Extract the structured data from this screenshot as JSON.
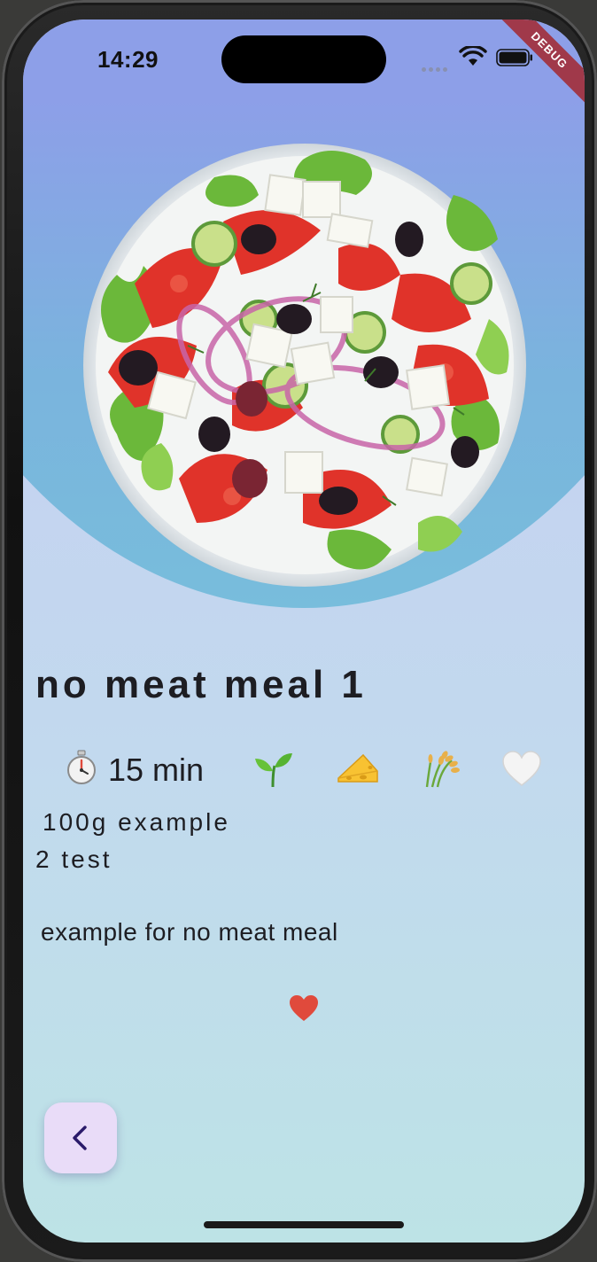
{
  "status_bar": {
    "time": "14:29",
    "icons": [
      "signal-dots-icon",
      "wifi-icon",
      "battery-icon"
    ]
  },
  "debug_banner": "DEBUG",
  "recipe": {
    "image": "greek-salad-plate",
    "title": "no meat meal 1",
    "time": "15 min",
    "tags": [
      "timer-icon",
      "sprout-icon",
      "cheese-icon",
      "grain-icon",
      "white-heart-icon"
    ],
    "ingredients": [
      "100g example",
      "2 test"
    ],
    "description": "example for no meat meal"
  },
  "colors": {
    "hero_top": "#8d9fe8",
    "hero_bottom": "#78bddc",
    "background": "#c2d9ee",
    "favorite_heart": "#e04a3c",
    "back_button": "#e9dcf8",
    "debug_banner": "#a0394a"
  },
  "navigation": {
    "back_icon": "chevron-left-icon"
  }
}
